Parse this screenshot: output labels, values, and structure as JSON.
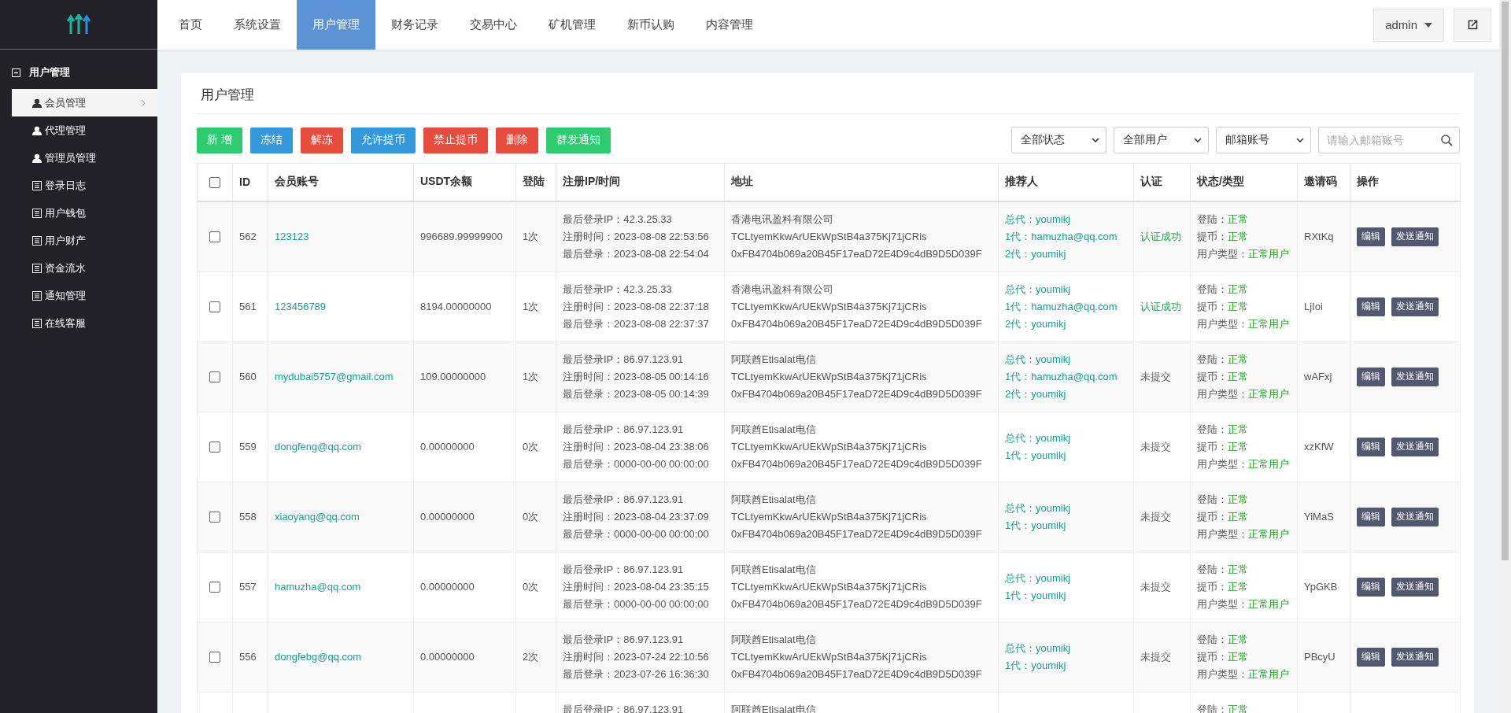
{
  "top_nav": {
    "tabs": [
      {
        "label": "首页",
        "selected": false
      },
      {
        "label": "系统设置",
        "selected": false
      },
      {
        "label": "用户管理",
        "selected": true
      },
      {
        "label": "财务记录",
        "selected": false
      },
      {
        "label": "交易中心",
        "selected": false
      },
      {
        "label": "矿机管理",
        "selected": false
      },
      {
        "label": "新币认购",
        "selected": false
      },
      {
        "label": "内容管理",
        "selected": false
      }
    ],
    "user": "admin"
  },
  "sidebar": {
    "group": "用户管理",
    "expanded": true,
    "items": [
      {
        "label": "会员管理",
        "kind": "person",
        "selected": true
      },
      {
        "label": "代理管理",
        "kind": "person",
        "selected": false
      },
      {
        "label": "管理员管理",
        "kind": "person",
        "selected": false
      },
      {
        "label": "登录日志",
        "kind": "page",
        "selected": false
      },
      {
        "label": "用户钱包",
        "kind": "page",
        "selected": false
      },
      {
        "label": "用户财产",
        "kind": "page",
        "selected": false
      },
      {
        "label": "资金流水",
        "kind": "page",
        "selected": false
      },
      {
        "label": "通知管理",
        "kind": "page",
        "selected": false
      },
      {
        "label": "在线客服",
        "kind": "page",
        "selected": false
      }
    ]
  },
  "panel": {
    "title": "用户管理",
    "actions": [
      {
        "label": "新 增",
        "kind": "success"
      },
      {
        "label": "冻结",
        "kind": "info"
      },
      {
        "label": "解冻",
        "kind": "danger"
      },
      {
        "label": "允许提币",
        "kind": "info"
      },
      {
        "label": "禁止提币",
        "kind": "danger"
      },
      {
        "label": "删除",
        "kind": "danger"
      },
      {
        "label": "群发通知",
        "kind": "success"
      }
    ],
    "filters": [
      "全部状态",
      "全部用户",
      "邮箱账号"
    ],
    "search": {
      "placeholder": "请输入邮箱账号"
    },
    "table": {
      "header_checked": false,
      "columns": [
        "ID",
        "会员账号",
        "USDT余额",
        "登陆",
        "注册IP/时间",
        "地址",
        "推荐人",
        "认证",
        "状态/类型",
        "邀请码",
        "操作"
      ],
      "rows": [
        {
          "checked": false,
          "id": "562",
          "account": "123123",
          "balance": "996689.99999900",
          "logins": "1次",
          "register": [
            "最后登录IP：42.3.25.33",
            "注册时间：2023-08-08 22:53:56",
            "最后登录：2023-08-08 22:54:04"
          ],
          "address": [
            "香港电讯盈科有限公司",
            "TCLtyemKkwArUEkWpStB4a375Kj71jCRis",
            "0xFB4704b069a20B45F17eaD72E4D9c4dB9D5D039F"
          ],
          "referrers": [
            "总代：youmikj",
            "1代：hamuzha@qq.com",
            "2代：youmikj"
          ],
          "verification": "认证成功",
          "verified": true,
          "status": [
            {
              "label": "登陆：",
              "value": "正常"
            },
            {
              "label": "提币：",
              "value": "正常"
            },
            {
              "label": "用户类型：",
              "value": "正常用户"
            }
          ],
          "invite_code": "RXtKq",
          "buttons": [
            "编辑",
            "发送通知"
          ]
        },
        {
          "checked": false,
          "id": "561",
          "account": "123456789",
          "balance": "8194.00000000",
          "logins": "1次",
          "register": [
            "最后登录IP：42.3.25.33",
            "注册时间：2023-08-08 22:37:18",
            "最后登录：2023-08-08 22:37:37"
          ],
          "address": [
            "香港电讯盈科有限公司",
            "TCLtyemKkwArUEkWpStB4a375Kj71jCRis",
            "0xFB4704b069a20B45F17eaD72E4D9c4dB9D5D039F"
          ],
          "referrers": [
            "总代：youmikj",
            "1代：hamuzha@qq.com",
            "2代：youmikj"
          ],
          "verification": "认证成功",
          "verified": true,
          "status": [
            {
              "label": "登陆：",
              "value": "正常"
            },
            {
              "label": "提币：",
              "value": "正常"
            },
            {
              "label": "用户类型：",
              "value": "正常用户"
            }
          ],
          "invite_code": "LjIoi",
          "buttons": [
            "编辑",
            "发送通知"
          ]
        },
        {
          "checked": false,
          "id": "560",
          "account": "mydubai5757@gmail.com",
          "balance": "109.00000000",
          "logins": "1次",
          "register": [
            "最后登录IP：86.97.123.91",
            "注册时间：2023-08-05 00:14:16",
            "最后登录：2023-08-05 00:14:39"
          ],
          "address": [
            "阿联酋Etisalat电信",
            "TCLtyemKkwArUEkWpStB4a375Kj71jCRis",
            "0xFB4704b069a20B45F17eaD72E4D9c4dB9D5D039F"
          ],
          "referrers": [
            "总代：youmikj",
            "1代：hamuzha@qq.com",
            "2代：youmikj"
          ],
          "verification": "未提交",
          "verified": false,
          "status": [
            {
              "label": "登陆：",
              "value": "正常"
            },
            {
              "label": "提币：",
              "value": "正常"
            },
            {
              "label": "用户类型：",
              "value": "正常用户"
            }
          ],
          "invite_code": "wAFxj",
          "buttons": [
            "编辑",
            "发送通知"
          ]
        },
        {
          "checked": false,
          "id": "559",
          "account": "dongfeng@qq.com",
          "balance": "0.00000000",
          "logins": "0次",
          "register": [
            "最后登录IP：86.97.123.91",
            "注册时间：2023-08-04 23:38:06",
            "最后登录：0000-00-00 00:00:00"
          ],
          "address": [
            "阿联酋Etisalat电信",
            "TCLtyemKkwArUEkWpStB4a375Kj71jCRis",
            "0xFB4704b069a20B45F17eaD72E4D9c4dB9D5D039F"
          ],
          "referrers": [
            "总代：youmikj",
            "1代：youmikj"
          ],
          "verification": "未提交",
          "verified": false,
          "status": [
            {
              "label": "登陆：",
              "value": "正常"
            },
            {
              "label": "提币：",
              "value": "正常"
            },
            {
              "label": "用户类型：",
              "value": "正常用户"
            }
          ],
          "invite_code": "xzKfW",
          "buttons": [
            "编辑",
            "发送通知"
          ]
        },
        {
          "checked": false,
          "id": "558",
          "account": "xiaoyang@qq.com",
          "balance": "0.00000000",
          "logins": "0次",
          "register": [
            "最后登录IP：86.97.123.91",
            "注册时间：2023-08-04 23:37:09",
            "最后登录：0000-00-00 00:00:00"
          ],
          "address": [
            "阿联酋Etisalat电信",
            "TCLtyemKkwArUEkWpStB4a375Kj71jCRis",
            "0xFB4704b069a20B45F17eaD72E4D9c4dB9D5D039F"
          ],
          "referrers": [
            "总代：youmikj",
            "1代：youmikj"
          ],
          "verification": "未提交",
          "verified": false,
          "status": [
            {
              "label": "登陆：",
              "value": "正常"
            },
            {
              "label": "提币：",
              "value": "正常"
            },
            {
              "label": "用户类型：",
              "value": "正常用户"
            }
          ],
          "invite_code": "YiMaS",
          "buttons": [
            "编辑",
            "发送通知"
          ]
        },
        {
          "checked": false,
          "id": "557",
          "account": "hamuzha@qq.com",
          "balance": "0.00000000",
          "logins": "0次",
          "register": [
            "最后登录IP：86.97.123.91",
            "注册时间：2023-08-04 23:35:15",
            "最后登录：0000-00-00 00:00:00"
          ],
          "address": [
            "阿联酋Etisalat电信",
            "TCLtyemKkwArUEkWpStB4a375Kj71jCRis",
            "0xFB4704b069a20B45F17eaD72E4D9c4dB9D5D039F"
          ],
          "referrers": [
            "总代：youmikj",
            "1代：youmikj"
          ],
          "verification": "未提交",
          "verified": false,
          "status": [
            {
              "label": "登陆：",
              "value": "正常"
            },
            {
              "label": "提币：",
              "value": "正常"
            },
            {
              "label": "用户类型：",
              "value": "正常用户"
            }
          ],
          "invite_code": "YpGKB",
          "buttons": [
            "编辑",
            "发送通知"
          ]
        },
        {
          "checked": false,
          "id": "556",
          "account": "dongfebg@qq.com",
          "balance": "0.00000000",
          "logins": "2次",
          "register": [
            "最后登录IP：86.97.123.91",
            "注册时间：2023-07-24 22:10:56",
            "最后登录：2023-07-26 16:36:30"
          ],
          "address": [
            "阿联酋Etisalat电信",
            "TCLtyemKkwArUEkWpStB4a375Kj71jCRis",
            "0xFB4704b069a20B45F17eaD72E4D9c4dB9D5D039F"
          ],
          "referrers": [
            "总代：youmikj",
            "1代：youmikj"
          ],
          "verification": "未提交",
          "verified": false,
          "status": [
            {
              "label": "登陆：",
              "value": "正常"
            },
            {
              "label": "提币：",
              "value": "正常"
            },
            {
              "label": "用户类型：",
              "value": "正常用户"
            }
          ],
          "invite_code": "PBcyU",
          "buttons": [
            "编辑",
            "发送通知"
          ]
        },
        {
          "register": [
            "最后登录IP：86.97.123.91"
          ],
          "address": [
            "阿联酋Etisalat电信"
          ],
          "status": [
            {
              "label": "登陆：",
              "value": "正常"
            }
          ]
        }
      ]
    }
  }
}
